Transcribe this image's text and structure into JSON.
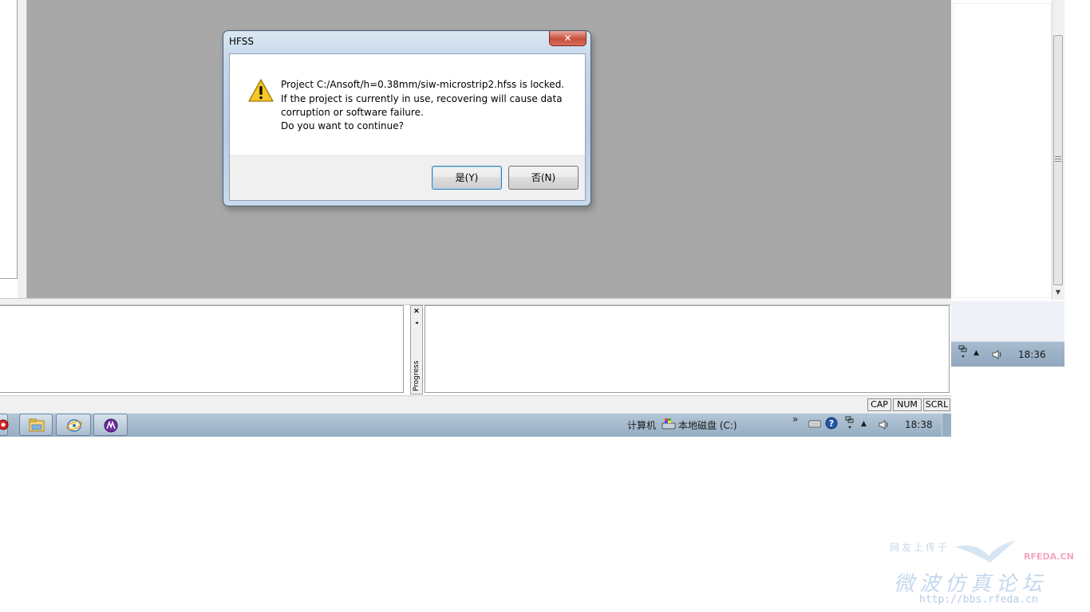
{
  "dialog": {
    "title": "HFSS",
    "close_glyph": "✕",
    "message_lines": [
      "Project C:/Ansoft/h=0.38mm/siw-microstrip2.hfss is locked.",
      "If the project is currently in use, recovering will cause data",
      "corruption or software failure.",
      "Do you want to continue?"
    ],
    "yes_label": "是(Y)",
    "no_label": "否(N)",
    "icon": "warning-icon"
  },
  "progress_dock": {
    "label": "Progress",
    "close_glyph": "×",
    "arrow_glyph": "◂"
  },
  "statusbar": {
    "cap": "CAP",
    "num": "NUM",
    "scrl": "SCRL"
  },
  "taskbar": {
    "computer_label": "计算机",
    "drive_label": "本地磁盘 (C:)",
    "chevron": "»",
    "clock": "18:38",
    "apps": [
      "hfss-icon",
      "file-explorer-icon",
      "browser-icon",
      "ansoft-icon"
    ]
  },
  "inner_tray": {
    "clock": "18:36"
  },
  "watermark": {
    "upload_text": "网友上传于",
    "brand": "RFEDA.CN",
    "forum_name": "微波仿真论坛",
    "url": "http://bbs.rfeda.cn"
  },
  "colors": {
    "workspace_bg": "#a8a8a8",
    "taskbar_bg": "#a9bdcf",
    "dialog_close": "#c7503d"
  }
}
